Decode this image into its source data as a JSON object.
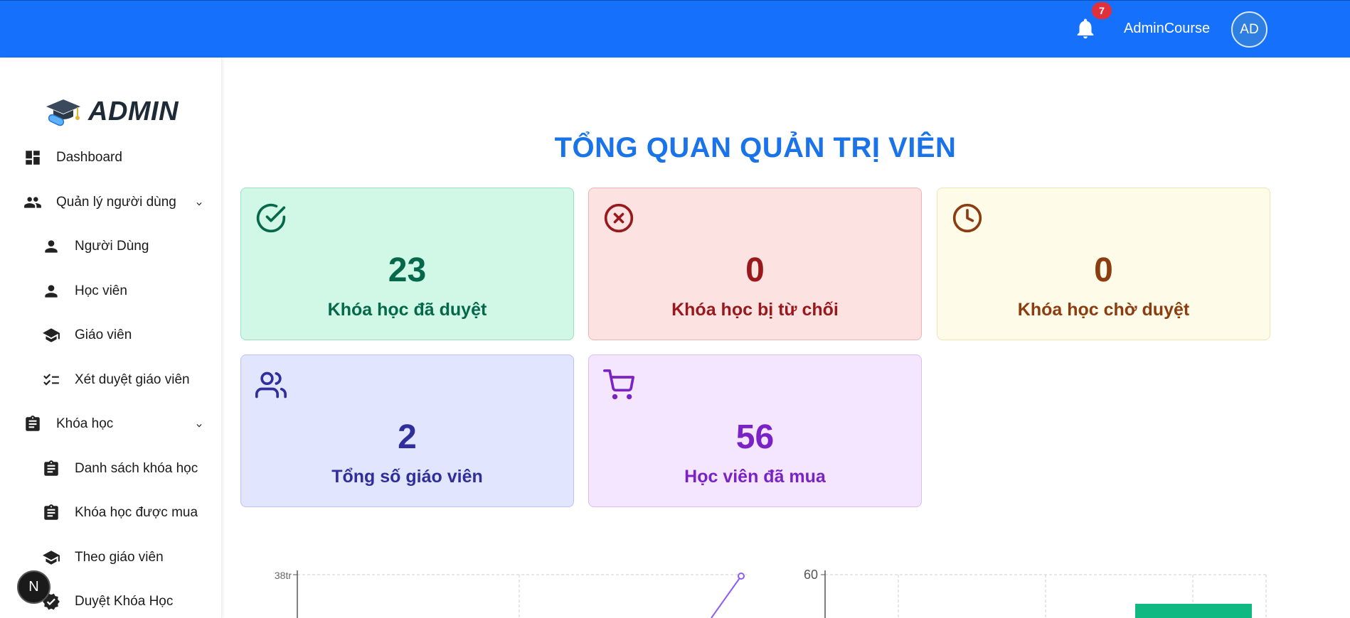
{
  "header": {
    "notification_count": "7",
    "username": "AdminCourse",
    "avatar_initials": "AD",
    "bar_color": "#1570fb"
  },
  "sidebar": {
    "brand": "ADMIN",
    "items": [
      {
        "label": "Dashboard",
        "icon": "dashboard-icon"
      },
      {
        "label": "Quản lý người dùng",
        "icon": "users-icon",
        "expandable": true
      },
      {
        "label": "Người Dùng",
        "icon": "person-icon"
      },
      {
        "label": "Học viên",
        "icon": "person-icon"
      },
      {
        "label": "Giáo viên",
        "icon": "school-icon"
      },
      {
        "label": "Xét duyệt giáo viên",
        "icon": "checklist-icon"
      },
      {
        "label": "Khóa học",
        "icon": "clipboard-icon",
        "expandable": true
      },
      {
        "label": "Danh sách khóa học",
        "icon": "clipboard-icon"
      },
      {
        "label": "Khóa học được mua",
        "icon": "clipboard-icon"
      },
      {
        "label": "Theo giáo viên",
        "icon": "school-icon"
      },
      {
        "label": "Duyệt Khóa Học",
        "icon": "verified-icon"
      }
    ],
    "floating_button": "N"
  },
  "main": {
    "title": "TỔNG QUAN QUẢN TRỊ VIÊN",
    "stats": [
      {
        "value": "23",
        "label": "Khóa học đã duyệt",
        "icon": "check-circle-icon",
        "color": "#05684a"
      },
      {
        "value": "0",
        "label": "Khóa học bị từ chối",
        "icon": "x-circle-icon",
        "color": "#99181c"
      },
      {
        "value": "0",
        "label": "Khóa học chờ duyệt",
        "icon": "clock-icon",
        "color": "#8b3d10"
      },
      {
        "value": "2",
        "label": "Tổng số giáo viên",
        "icon": "users-outline-icon",
        "color": "#2f2e9a"
      },
      {
        "value": "56",
        "label": "Học viên đã mua",
        "icon": "cart-icon",
        "color": "#7b22c6"
      }
    ]
  },
  "chart_data": [
    {
      "type": "line",
      "y_tick_labels": [
        "38tr"
      ],
      "series": [
        {
          "values": [
            38
          ]
        }
      ],
      "grid": true,
      "line_color": "#8b5cf6"
    },
    {
      "type": "bar",
      "y_tick_labels": [
        "60"
      ],
      "grid": true,
      "bar_color": "#10b981"
    }
  ]
}
